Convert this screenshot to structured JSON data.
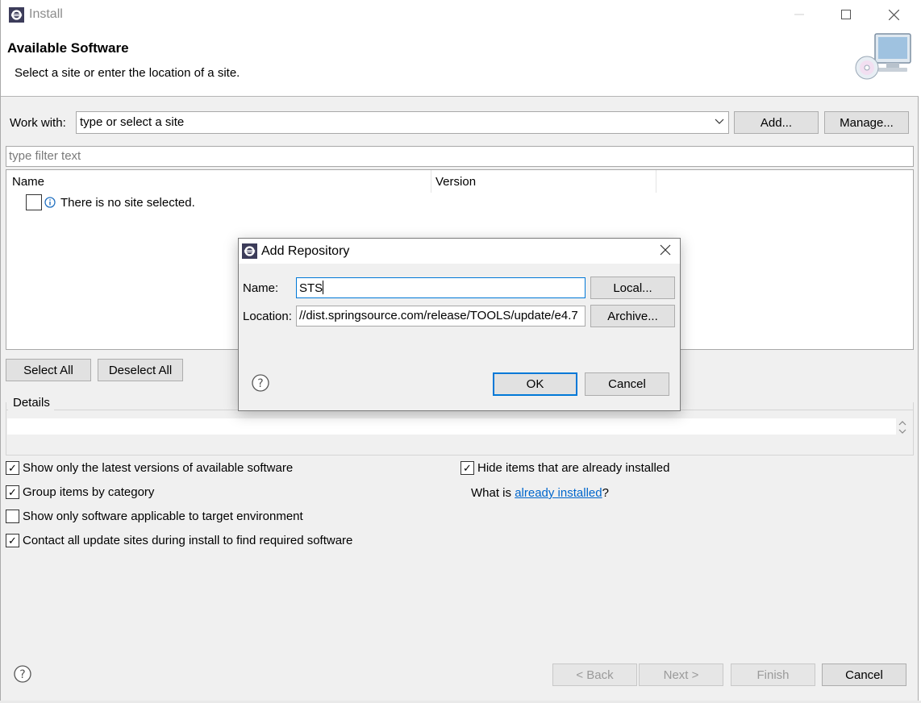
{
  "window": {
    "title": "Install"
  },
  "header": {
    "title": "Available Software",
    "subtitle": "Select a site or enter the location of a site."
  },
  "work_with": {
    "label": "Work with:",
    "value": "type or select a site",
    "add_label": "Add...",
    "manage_label": "Manage..."
  },
  "filter": {
    "placeholder": "type filter text"
  },
  "tree": {
    "columns": [
      "Name",
      "Version"
    ],
    "message": "There is no site selected."
  },
  "selection": {
    "select_all": "Select All",
    "deselect_all": "Deselect All"
  },
  "details": {
    "label": "Details"
  },
  "options": [
    {
      "label": "Show only the latest versions of available software",
      "checked": true
    },
    {
      "label": "Group items by category",
      "checked": true
    },
    {
      "label": "Show only software applicable to target environment",
      "checked": false
    },
    {
      "label": "Contact all update sites during install to find required software",
      "checked": true
    },
    {
      "label": "Hide items that are already installed",
      "checked": true
    }
  ],
  "installed_link": {
    "prefix": "What is ",
    "link": "already installed",
    "suffix": "?"
  },
  "footer": {
    "back": "< Back",
    "next": "Next >",
    "finish": "Finish",
    "cancel": "Cancel"
  },
  "dialog": {
    "title": "Add Repository",
    "name_label": "Name:",
    "name_value": "STS",
    "location_label": "Location:",
    "location_value": "//dist.springsource.com/release/TOOLS/update/e4.7",
    "local_label": "Local...",
    "archive_label": "Archive...",
    "ok_label": "OK",
    "cancel_label": "Cancel"
  },
  "colors": {
    "link": "#0066cc",
    "focus": "#0078d7",
    "window_bg": "#f0f0f0"
  }
}
